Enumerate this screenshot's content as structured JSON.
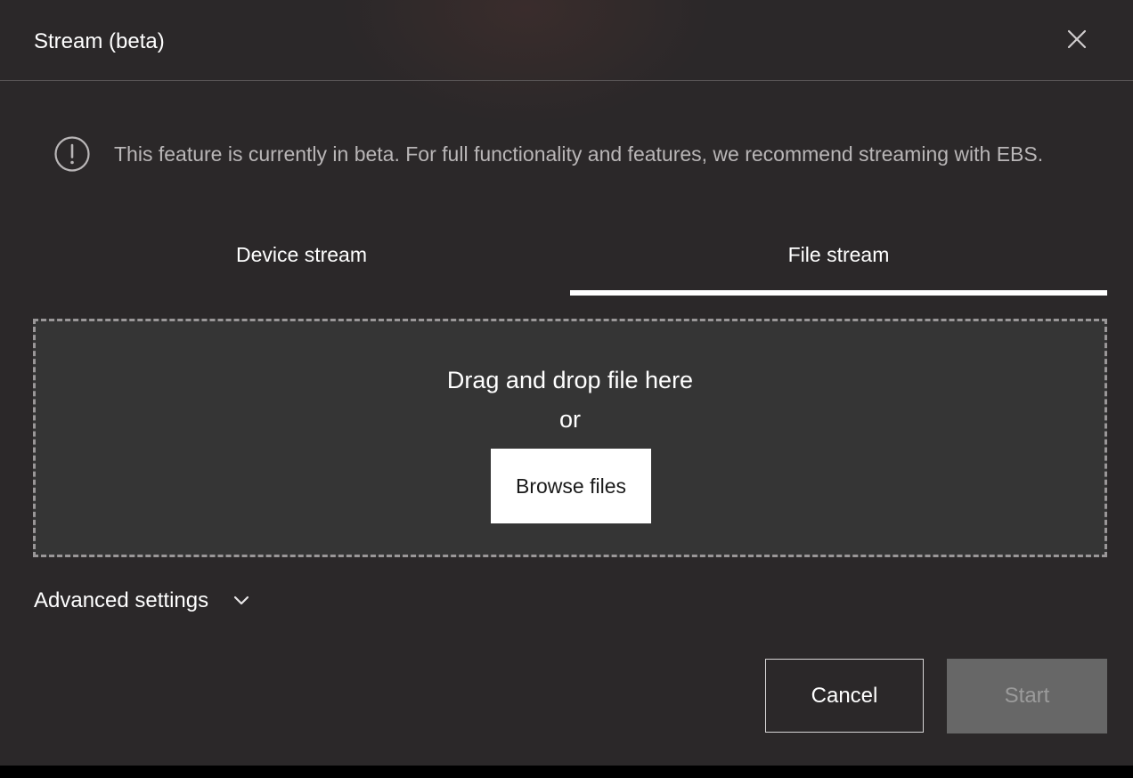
{
  "dialog": {
    "title": "Stream (beta)",
    "close_icon": "close-icon"
  },
  "banner": {
    "icon": "info-exclamation-icon",
    "text": "This feature is currently in beta. For full functionality and features, we recommend streaming with EBS."
  },
  "tabs": [
    {
      "label": "Device stream",
      "active": false
    },
    {
      "label": "File stream",
      "active": true
    }
  ],
  "dropzone": {
    "line1": "Drag and drop file here",
    "line2": "or",
    "browse_label": "Browse files"
  },
  "advanced": {
    "label": "Advanced settings",
    "icon": "chevron-down-icon"
  },
  "footer": {
    "cancel_label": "Cancel",
    "start_label": "Start",
    "start_enabled": false
  },
  "colors": {
    "dialog_bg": "#2b2829",
    "dropzone_bg": "#353535",
    "text_primary": "#ffffff",
    "text_muted": "#b9b6b7",
    "disabled_bg": "#676767"
  }
}
